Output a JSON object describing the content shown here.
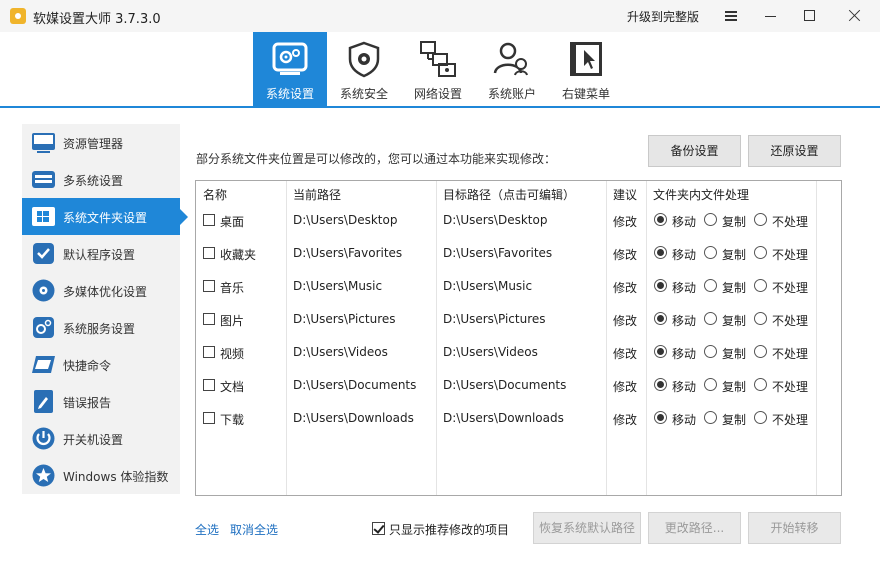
{
  "window": {
    "title": "软媒设置大师 3.7.3.0",
    "upgrade_label": "升级到完整版"
  },
  "tabs": [
    {
      "label": "系统设置",
      "icon": "gear-panel-icon",
      "active": true
    },
    {
      "label": "系统安全",
      "icon": "shield-gear-icon",
      "active": false
    },
    {
      "label": "网络设置",
      "icon": "network-icon",
      "active": false
    },
    {
      "label": "系统账户",
      "icon": "users-icon",
      "active": false
    },
    {
      "label": "右键菜单",
      "icon": "context-menu-icon",
      "active": false
    }
  ],
  "sidebar": {
    "items": [
      {
        "label": "资源管理器",
        "icon": "explorer-icon",
        "active": false
      },
      {
        "label": "多系统设置",
        "icon": "multi-system-icon",
        "active": false
      },
      {
        "label": "系统文件夹设置",
        "icon": "system-folder-icon",
        "active": true
      },
      {
        "label": "默认程序设置",
        "icon": "default-program-icon",
        "active": false
      },
      {
        "label": "多媒体优化设置",
        "icon": "multimedia-icon",
        "active": false
      },
      {
        "label": "系统服务设置",
        "icon": "service-icon",
        "active": false
      },
      {
        "label": "快捷命令",
        "icon": "shortcut-icon",
        "active": false
      },
      {
        "label": "错误报告",
        "icon": "error-report-icon",
        "active": false
      },
      {
        "label": "开关机设置",
        "icon": "power-icon",
        "active": false
      },
      {
        "label": "Windows 体验指数",
        "icon": "star-icon",
        "active": false
      }
    ]
  },
  "main": {
    "description": "部分系统文件夹位置是可以修改的，您可以通过本功能来实现修改：",
    "backup_label": "备份设置",
    "restore_label": "还原设置",
    "table": {
      "headers": [
        "名称",
        "当前路径",
        "目标路径（点击可编辑）",
        "建议",
        "文件夹内文件处理"
      ],
      "option_labels": [
        "移动",
        "复制",
        "不处理"
      ],
      "rows": [
        {
          "name": "桌面",
          "current": "D:\\Users\\Desktop",
          "target": "D:\\Users\\Desktop",
          "suggest": "修改",
          "checked": false,
          "option": 0
        },
        {
          "name": "收藏夹",
          "current": "D:\\Users\\Favorites",
          "target": "D:\\Users\\Favorites",
          "suggest": "修改",
          "checked": false,
          "option": 0
        },
        {
          "name": "音乐",
          "current": "D:\\Users\\Music",
          "target": "D:\\Users\\Music",
          "suggest": "修改",
          "checked": false,
          "option": 0
        },
        {
          "name": "图片",
          "current": "D:\\Users\\Pictures",
          "target": "D:\\Users\\Pictures",
          "suggest": "修改",
          "checked": false,
          "option": 0
        },
        {
          "name": "视频",
          "current": "D:\\Users\\Videos",
          "target": "D:\\Users\\Videos",
          "suggest": "修改",
          "checked": false,
          "option": 0
        },
        {
          "name": "文档",
          "current": "D:\\Users\\Documents",
          "target": "D:\\Users\\Documents",
          "suggest": "修改",
          "checked": false,
          "option": 0
        },
        {
          "name": "下载",
          "current": "D:\\Users\\Downloads",
          "target": "D:\\Users\\Downloads",
          "suggest": "修改",
          "checked": false,
          "option": 0
        }
      ]
    },
    "select_all_label": "全选",
    "deselect_all_label": "取消全选",
    "only_recommended_label": "只显示推荐修改的项目",
    "only_recommended_checked": true,
    "restore_default_label": "恢复系统默认路径",
    "change_path_label": "更改路径...",
    "start_transfer_label": "开始转移"
  },
  "colors": {
    "accent": "#1f87d8",
    "sidebar_bg": "#f2f2f2",
    "link": "#1e6fc0"
  }
}
